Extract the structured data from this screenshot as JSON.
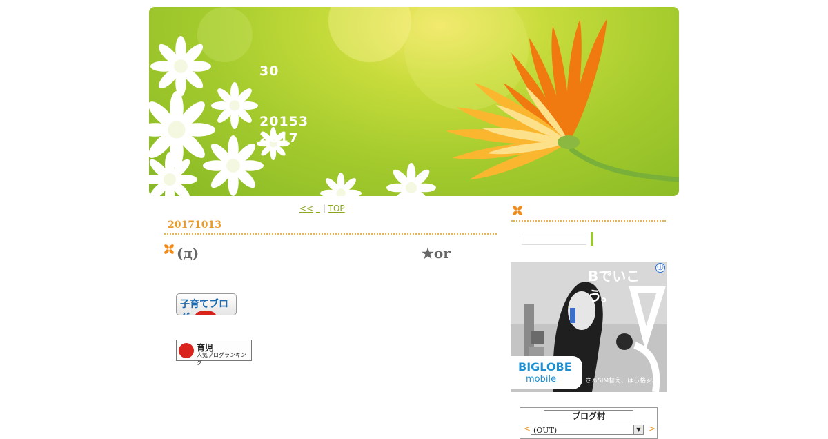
{
  "header": {
    "title": "30",
    "description_line1": "20153",
    "description_line2": "2017"
  },
  "nav": {
    "prev_link": "<<",
    "middle_link": "_",
    "separator": "|",
    "top_link": "TOP"
  },
  "post": {
    "date": "20171013",
    "title_left": "(д)",
    "title_right": "★or"
  },
  "badges": {
    "kosodate_label": "子育てブログ",
    "ikuji_line1": "育児",
    "ikuji_line2": "人気ブログランキング"
  },
  "sidebar": {
    "search_value": ""
  },
  "ad": {
    "headline": "Bでいこう。",
    "brand": "BIGLOBE",
    "sub_brand": "mobile",
    "tagline": "さぁSIM替え、ほら格安。",
    "info_glyph": "ⓘ"
  },
  "blog_village": {
    "logo_text": "ブログ村",
    "prev": "<",
    "selected": "(OUT)",
    "next": ">"
  },
  "colors": {
    "accent_orange": "#e89a2a",
    "link_green": "#8aa61e",
    "header_green": "#a6cc2e"
  }
}
